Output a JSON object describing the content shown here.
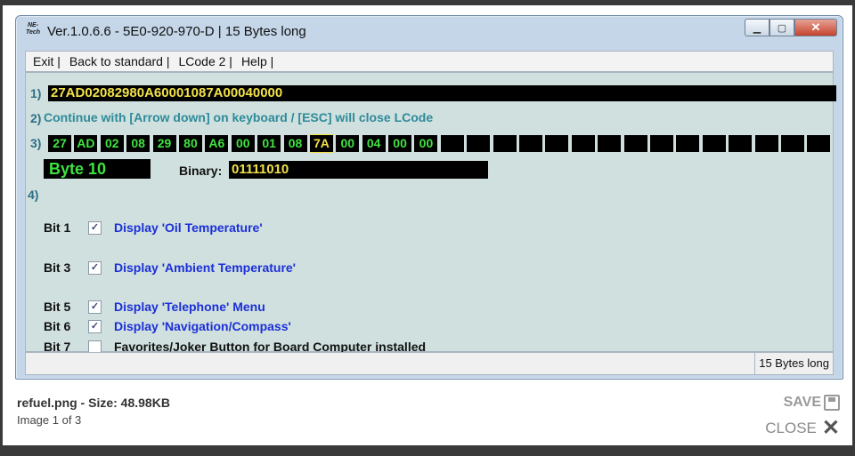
{
  "window": {
    "logo_text": "NE-Tech",
    "title": "Ver.1.0.6.6 -   5E0-920-970-D | 15 Bytes long",
    "btn_min": "▁",
    "btn_max": "▢",
    "btn_close": "✕"
  },
  "menu": {
    "exit": "Exit |",
    "back": "Back to standard |",
    "lcode2": "LCode 2 |",
    "help": "Help |"
  },
  "step1": {
    "num": "1)",
    "code": "27AD02082980A60001087A00040000"
  },
  "step2": {
    "num": "2)",
    "hint": "Continue with [Arrow down] on keyboard / [ESC] will close LCode"
  },
  "step3": {
    "num": "3)",
    "bytes": [
      "27",
      "AD",
      "02",
      "08",
      "29",
      "80",
      "A6",
      "00",
      "01",
      "08",
      "7A",
      "00",
      "04",
      "00",
      "00",
      "",
      "",
      "",
      "",
      "",
      "",
      "",
      "",
      "",
      "",
      "",
      "",
      "",
      "",
      ""
    ],
    "selected_index": 10
  },
  "byte_label": "Byte 10",
  "binary_label": "Binary:",
  "binary_value": "01111010",
  "step4": {
    "num": "4)"
  },
  "bits": [
    {
      "name": "Bit 1",
      "checked": true,
      "desc": "Display 'Oil Temperature'"
    },
    {
      "name": "Bit 3",
      "checked": true,
      "desc": "Display 'Ambient Temperature'"
    },
    {
      "name": "Bit 5",
      "checked": true,
      "desc": "Display 'Telephone' Menu"
    },
    {
      "name": "Bit 6",
      "checked": true,
      "desc": "Display 'Navigation/Compass'"
    },
    {
      "name": "Bit 7",
      "checked": false,
      "desc": "Favorites/Joker Button for Board Computer installed"
    }
  ],
  "status_text": "15 Bytes long",
  "caption": {
    "file": "refuel.png - Size: 48.98KB",
    "counter": "Image 1 of 3"
  },
  "actions": {
    "save": "SAVE",
    "close": "CLOSE"
  },
  "colors": {
    "byte_text": "#3fe33f",
    "code_text": "#f3e24a",
    "desc_blue": "#1c2fd8",
    "hint_teal": "#2f8a9a"
  }
}
